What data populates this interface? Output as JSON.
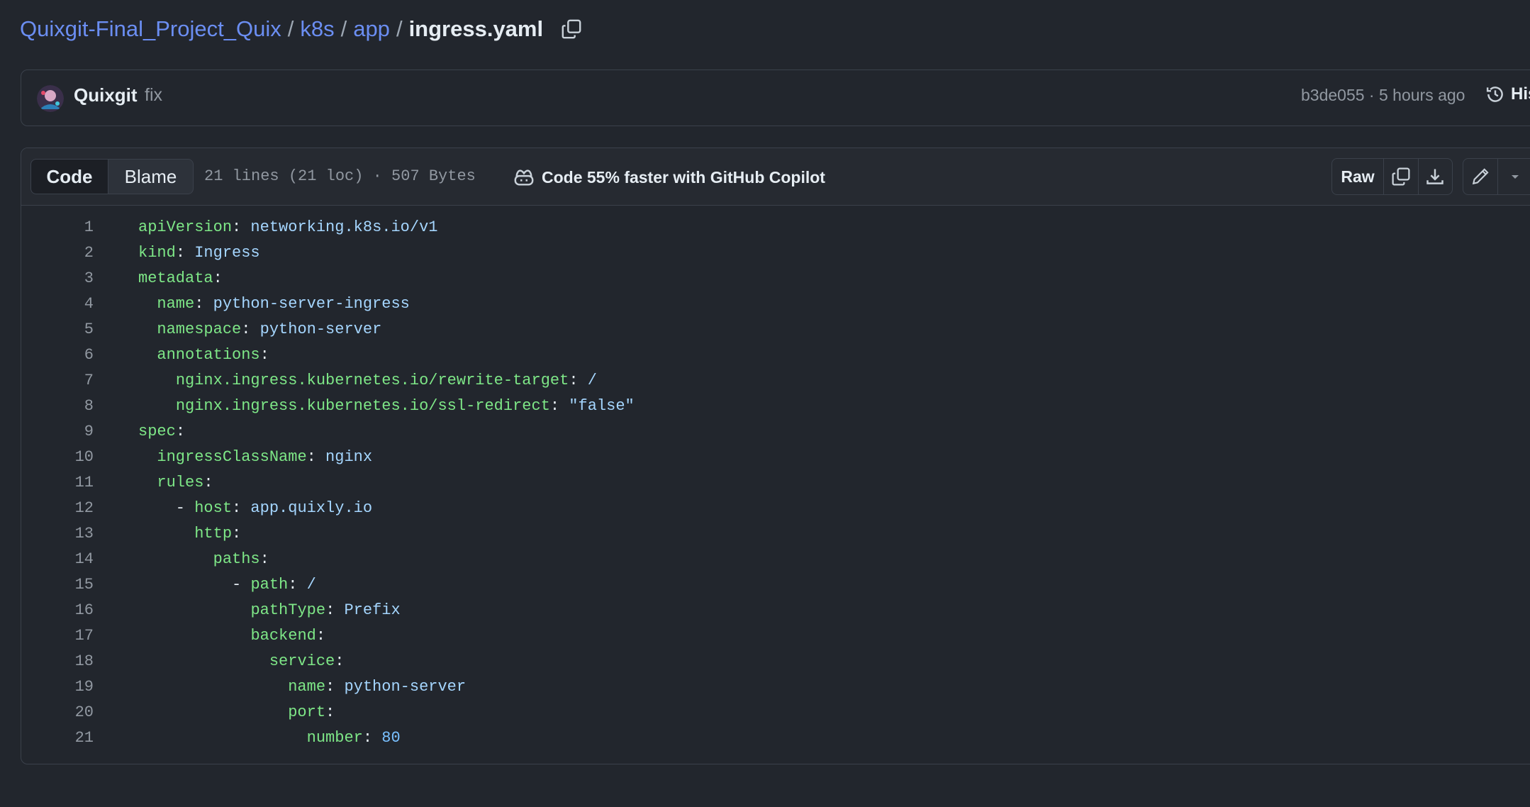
{
  "breadcrumb": {
    "repo": "Quixgit-Final_Project_Quix",
    "dir1": "k8s",
    "dir2": "app",
    "file": "ingress.yaml",
    "sep": "/"
  },
  "commit": {
    "author": "Quixgit",
    "message": "fix",
    "meta": "b3de055 · 5 hours ago",
    "history_label": "History"
  },
  "file_header": {
    "code_tab": "Code",
    "blame_tab": "Blame",
    "info": "21 lines (21 loc) · 507 Bytes",
    "copilot": "Code 55% faster with GitHub Copilot",
    "raw": "Raw"
  },
  "colors": {
    "link": "#6b8ef2",
    "key": "#7ee787",
    "string": "#a5d6ff",
    "number": "#79c0ff",
    "background": "#22262d"
  },
  "code_lines": [
    {
      "num": "1",
      "indent": "",
      "dash": "",
      "key": "apiVersion",
      "val": "networking.k8s.io/v1",
      "vtype": "v"
    },
    {
      "num": "2",
      "indent": "",
      "dash": "",
      "key": "kind",
      "val": "Ingress",
      "vtype": "v"
    },
    {
      "num": "3",
      "indent": "",
      "dash": "",
      "key": "metadata",
      "val": "",
      "vtype": "v"
    },
    {
      "num": "4",
      "indent": "  ",
      "dash": "",
      "key": "name",
      "val": "python-server-ingress",
      "vtype": "v"
    },
    {
      "num": "5",
      "indent": "  ",
      "dash": "",
      "key": "namespace",
      "val": "python-server",
      "vtype": "v"
    },
    {
      "num": "6",
      "indent": "  ",
      "dash": "",
      "key": "annotations",
      "val": "",
      "vtype": "v"
    },
    {
      "num": "7",
      "indent": "    ",
      "dash": "",
      "key": "nginx.ingress.kubernetes.io/rewrite-target",
      "val": "/",
      "vtype": "v"
    },
    {
      "num": "8",
      "indent": "    ",
      "dash": "",
      "key": "nginx.ingress.kubernetes.io/ssl-redirect",
      "val": "\"false\"",
      "vtype": "v"
    },
    {
      "num": "9",
      "indent": "",
      "dash": "",
      "key": "spec",
      "val": "",
      "vtype": "v"
    },
    {
      "num": "10",
      "indent": "  ",
      "dash": "",
      "key": "ingressClassName",
      "val": "nginx",
      "vtype": "v"
    },
    {
      "num": "11",
      "indent": "  ",
      "dash": "",
      "key": "rules",
      "val": "",
      "vtype": "v"
    },
    {
      "num": "12",
      "indent": "    ",
      "dash": "- ",
      "key": "host",
      "val": "app.quixly.io",
      "vtype": "v"
    },
    {
      "num": "13",
      "indent": "      ",
      "dash": "",
      "key": "http",
      "val": "",
      "vtype": "v"
    },
    {
      "num": "14",
      "indent": "        ",
      "dash": "",
      "key": "paths",
      "val": "",
      "vtype": "v"
    },
    {
      "num": "15",
      "indent": "          ",
      "dash": "- ",
      "key": "path",
      "val": "/",
      "vtype": "v"
    },
    {
      "num": "16",
      "indent": "            ",
      "dash": "",
      "key": "pathType",
      "val": "Prefix",
      "vtype": "v"
    },
    {
      "num": "17",
      "indent": "            ",
      "dash": "",
      "key": "backend",
      "val": "",
      "vtype": "v"
    },
    {
      "num": "18",
      "indent": "              ",
      "dash": "",
      "key": "service",
      "val": "",
      "vtype": "v"
    },
    {
      "num": "19",
      "indent": "                ",
      "dash": "",
      "key": "name",
      "val": "python-server",
      "vtype": "v"
    },
    {
      "num": "20",
      "indent": "                ",
      "dash": "",
      "key": "port",
      "val": "",
      "vtype": "v"
    },
    {
      "num": "21",
      "indent": "                  ",
      "dash": "",
      "key": "number",
      "val": "80",
      "vtype": "n"
    }
  ]
}
